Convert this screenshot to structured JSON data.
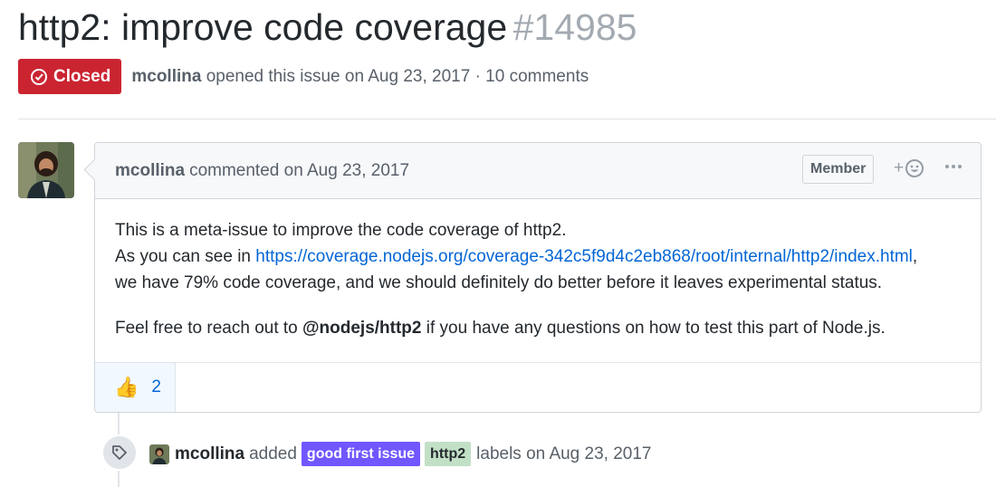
{
  "issue": {
    "title": "http2: improve code coverage",
    "number": "#14985",
    "state": "Closed",
    "author": "mcollina",
    "opened_text": "opened this issue on Aug 23, 2017 · 10 comments"
  },
  "comment": {
    "author": "mcollina",
    "action": "commented on Aug 23, 2017",
    "role_badge": "Member",
    "add_reaction_symbol": "+",
    "body": {
      "line1": "This is a meta-issue to improve the code coverage of http2.",
      "line2_prefix": "As you can see in ",
      "link": "https://coverage.nodejs.org/coverage-342c5f9d4c2eb868/root/internal/http2/index.html",
      "line2_suffix": ",",
      "line3": "we have 79% code coverage, and we should definitely do better before it leaves experimental status.",
      "p2_prefix": "Feel free to reach out to ",
      "mention": "@nodejs/http2",
      "p2_suffix": " if you have any questions on how to test this part of Node.js."
    },
    "reactions": [
      {
        "emoji": "👍",
        "count": "2"
      }
    ]
  },
  "event": {
    "actor": "mcollina",
    "action": "added",
    "labels": [
      {
        "name": "good first issue",
        "color": "#7057ff"
      },
      {
        "name": "http2",
        "color": "#c2e0c6"
      }
    ],
    "tail": "labels on Aug 23, 2017"
  },
  "colors": {
    "closed": "#cb2431",
    "link": "#0366d6",
    "muted": "#586069"
  }
}
